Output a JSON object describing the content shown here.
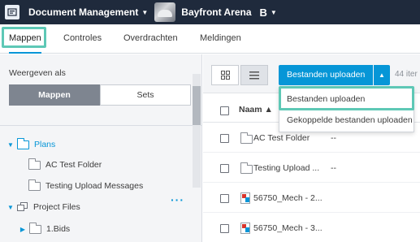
{
  "header": {
    "app_title": "Document Management",
    "project_name": "Bayfront Arena",
    "brand_letter": "B",
    "colors": {
      "topbar": "#1f2a3c",
      "accent": "#0696d7",
      "highlight": "#5ec8b6"
    }
  },
  "tabs": [
    {
      "label": "Mappen",
      "active": true
    },
    {
      "label": "Controles",
      "active": false
    },
    {
      "label": "Overdrachten",
      "active": false
    },
    {
      "label": "Meldingen",
      "active": false
    }
  ],
  "sidebar": {
    "show_as_label": "Weergeven als",
    "toggle": {
      "folders": "Mappen",
      "sets": "Sets"
    },
    "tree": [
      {
        "label": "Plans",
        "icon": "folder-blue-icon"
      },
      {
        "label": "AC Test Folder",
        "icon": "folder-icon"
      },
      {
        "label": "Testing Upload Messages",
        "icon": "folder-icon"
      },
      {
        "label": "Project Files",
        "icon": "stack-icon"
      },
      {
        "label": "1.Bids",
        "icon": "folder-icon"
      }
    ],
    "more_icon": "more-dots-icon"
  },
  "toolbar": {
    "upload_label": "Bestanden uploaden",
    "item_count": "44 iter",
    "view_icons": [
      "grid-view-icon",
      "list-view-icon"
    ]
  },
  "dropdown": {
    "items": [
      "Bestanden uploaden",
      "Gekoppelde bestanden uploaden"
    ]
  },
  "table": {
    "name_header": "Naam",
    "sort_icon": "sort-up-icon",
    "rows": [
      {
        "name": "AC Test Folder",
        "extra": "--",
        "icon": "folder-icon"
      },
      {
        "name": "Testing Upload ...",
        "extra": "--",
        "icon": "folder-icon"
      },
      {
        "name": "56750_Mech - 2...",
        "extra": "",
        "icon": "dwg-file-icon"
      },
      {
        "name": "56750_Mech - 3...",
        "extra": "",
        "icon": "dwg-file-icon"
      }
    ]
  }
}
